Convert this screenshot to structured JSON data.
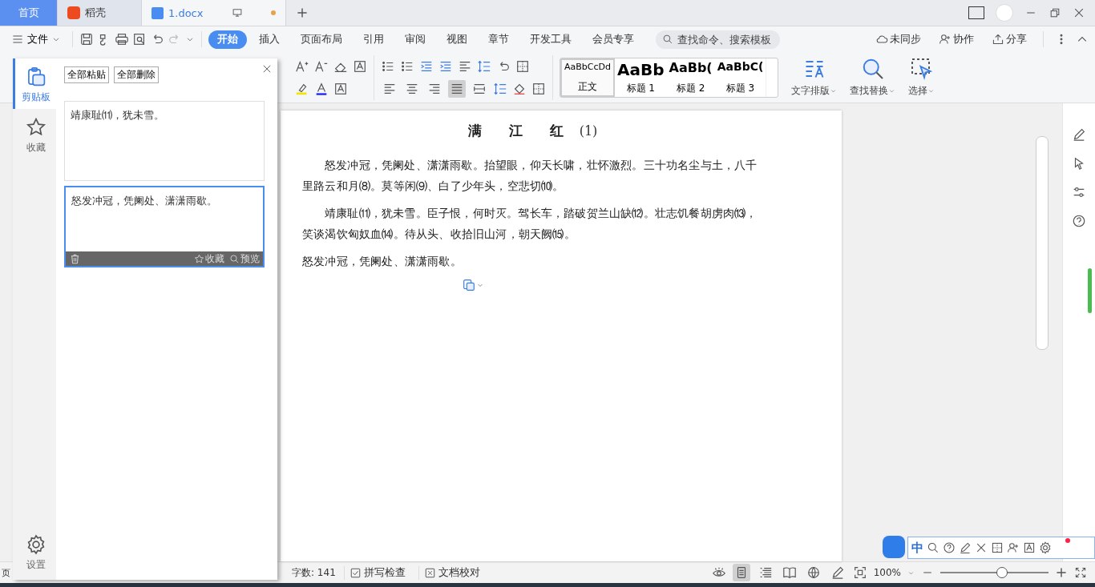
{
  "tabs": [
    {
      "kind": "home",
      "label": "首页",
      "selected": false
    },
    {
      "kind": "app",
      "label": "稻壳",
      "selected": false
    },
    {
      "kind": "doc",
      "label": "1.docx",
      "selected": true
    }
  ],
  "menu": {
    "file": "文件",
    "ribbon_tabs": [
      {
        "label": "开始",
        "selected": true
      },
      {
        "label": "插入",
        "selected": false
      },
      {
        "label": "页面布局",
        "selected": false
      },
      {
        "label": "引用",
        "selected": false
      },
      {
        "label": "审阅",
        "selected": false
      },
      {
        "label": "视图",
        "selected": false
      },
      {
        "label": "章节",
        "selected": false
      },
      {
        "label": "开发工具",
        "selected": false
      },
      {
        "label": "会员专享",
        "selected": false
      }
    ],
    "search": {
      "placeholder": "查找命令、搜索模板"
    },
    "actions": [
      "未同步",
      "协作",
      "分享"
    ]
  },
  "ribbon": {
    "paragraph_align": [
      {
        "selected": false
      },
      {
        "selected": false
      },
      {
        "selected": false
      },
      {
        "selected": true
      },
      {
        "selected": false
      }
    ],
    "styles": [
      {
        "sample": "AaBbCcDd",
        "name": "正文",
        "kind": "normal",
        "selected": true
      },
      {
        "sample": "AaBb",
        "name": "标题 1",
        "kind": "h1",
        "selected": false
      },
      {
        "sample": "AaBb(",
        "name": "标题 2",
        "kind": "h2",
        "selected": false
      },
      {
        "sample": "AaBbC(",
        "name": "标题 3",
        "kind": "h3",
        "selected": false
      }
    ],
    "big_buttons": [
      "文字排版",
      "查找替换",
      "选择"
    ]
  },
  "document": {
    "title": "满　　江　　红",
    "title_note": "(1)",
    "paragraphs": [
      {
        "kind": "indent",
        "text": "怒发冲冠，凭阑处、潇潇雨歇。抬望眼，仰天长啸，壮怀激烈。三十功名尘与土，八千里路云和月⑻。莫等闲⑼、白了少年头，空悲切⑽。"
      },
      {
        "kind": "indent",
        "text": "靖康耻⑾，犹未雪。臣子恨，何时灭。驾长车，踏破贺兰山缺⑿。壮志饥餐胡虏肉⒀，笑谈渴饮匈奴血⒁。待从头、收拾旧山河，朝天阙⒂。"
      },
      {
        "kind": "plain",
        "text": "怒发冲冠，凭阑处、潇潇雨歇。"
      }
    ]
  },
  "clipboard_panel": {
    "nav": [
      {
        "label": "剪贴板",
        "selected": true
      },
      {
        "label": "收藏",
        "selected": false
      }
    ],
    "settings": "设置",
    "buttons": [
      "全部粘贴",
      "全部删除"
    ],
    "items": [
      {
        "text": "靖康耻⑾，犹未雪。",
        "selected": false
      },
      {
        "text": "怒发冲冠，凭阑处、潇潇雨歇。",
        "selected": true
      }
    ],
    "item_actions": [
      "收藏",
      "预览"
    ]
  },
  "status_bar": {
    "page": "页",
    "word_count": "字数: 141",
    "checks": [
      "拼写检查",
      "文档校对"
    ],
    "view_modes": [
      {
        "selected": true
      },
      {
        "selected": false
      },
      {
        "selected": false
      },
      {
        "selected": false
      },
      {
        "selected": false
      }
    ],
    "zoom": "100%",
    "zoom_level": {
      "level": 0.57
    }
  },
  "ime_bar": {
    "mode": "中"
  }
}
